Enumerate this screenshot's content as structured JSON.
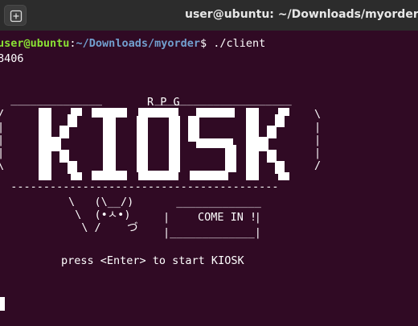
{
  "window": {
    "title": "user@ubuntu: ~/Downloads/myorder",
    "new_tab_icon": "new-tab-icon"
  },
  "terminal": {
    "prompt_user_host": "user@ubuntu",
    "prompt_sep": ":",
    "prompt_path": "~/Downloads/myorder",
    "prompt_symbol": "$",
    "command": " ./client",
    "output_pid": "8406",
    "banner": {
      "small_title": "R P G",
      "big_title": "KIOSK",
      "come_in": "COME IN !",
      "instruction": "press <Enter> to start KIOSK"
    }
  },
  "colors": {
    "background": "#300a24",
    "user_host": "#8ae234",
    "path": "#729fcf"
  }
}
